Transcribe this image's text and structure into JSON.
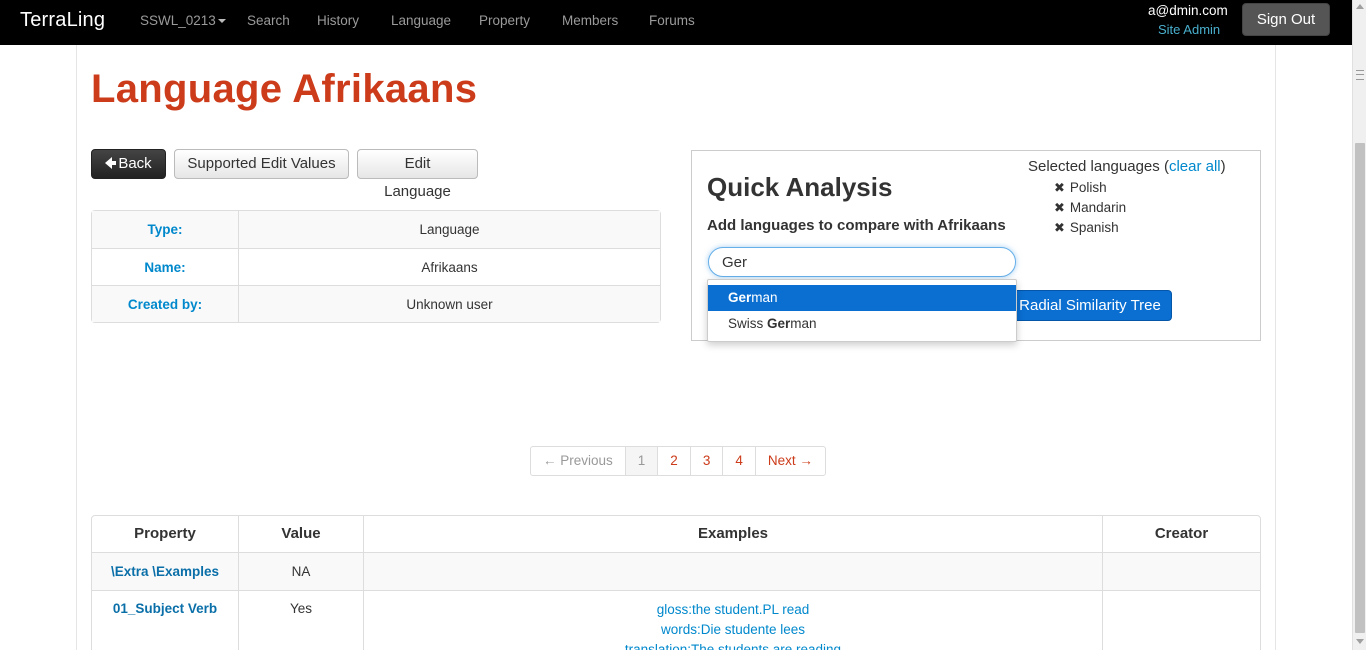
{
  "navbar": {
    "brand": "TerraLing",
    "group": "SSWL_0213",
    "items": [
      "Search",
      "History",
      "Language",
      "Property",
      "Members",
      "Forums"
    ],
    "user_email": "a@dmin.com",
    "user_role": "Site Admin",
    "signout_label": "Sign Out"
  },
  "page": {
    "title": "Language Afrikaans"
  },
  "toolbar": {
    "back_label": "Back",
    "supported_label": "Supported Edit Values",
    "edit_label": "Edit Language"
  },
  "info": [
    {
      "key": "Type:",
      "value": "Language"
    },
    {
      "key": "Name:",
      "value": "Afrikaans"
    },
    {
      "key": "Created by:",
      "value": "Unknown user"
    }
  ],
  "quick_analysis": {
    "title": "Quick Analysis",
    "subtitle": "Add languages to compare with Afrikaans",
    "input_value": "Ger",
    "radial_btn": "Radial Similarity Tree",
    "selected_label": "Selected languages (",
    "clear_all": "clear all",
    "selected_close": ")",
    "selected": [
      "Polish",
      "Mandarin",
      "Spanish"
    ]
  },
  "autocomplete": {
    "items": [
      {
        "match": "Ger",
        "rest": "man",
        "prefix": ""
      },
      {
        "match": "Ger",
        "rest": "man",
        "prefix": "Swiss "
      }
    ]
  },
  "pagination": {
    "prev": "← Previous",
    "pages": [
      "1",
      "2",
      "3",
      "4"
    ],
    "next": "Next →",
    "current": 1
  },
  "properties": {
    "headers": [
      "Property",
      "Value",
      "Examples",
      "Creator"
    ],
    "rows": [
      {
        "property": "\\Extra \\Examples",
        "value": "NA",
        "examples": [],
        "creator": ""
      },
      {
        "property": "01_Subject Verb",
        "value": "Yes",
        "examples": [
          "gloss:the student.PL read",
          "words:Die studente lees",
          "translation:The students are reading"
        ],
        "creator": ""
      }
    ]
  },
  "colors": {
    "title_red": "#cc3b1a",
    "link_blue": "#0088cc",
    "primary_blue": "#0a6fd1",
    "navbar_bg": "#000000"
  }
}
